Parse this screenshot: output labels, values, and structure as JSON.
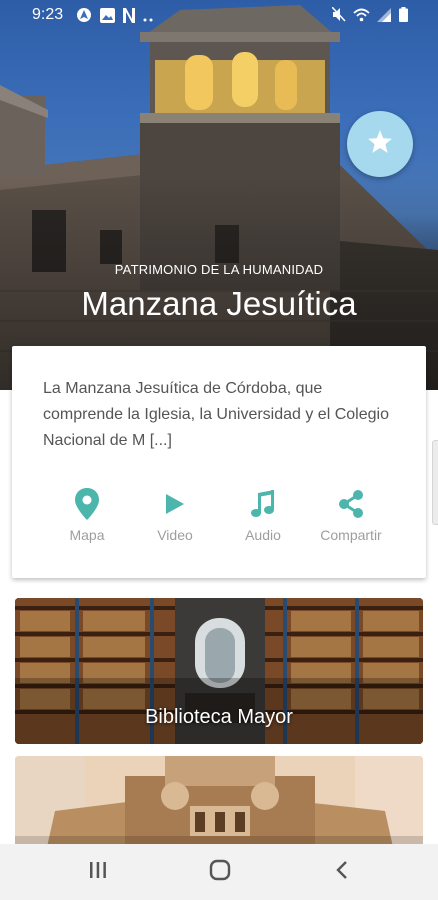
{
  "status_bar": {
    "time": "9:23",
    "left_icons": [
      "android-auto-icon",
      "image-icon",
      "netflix-icon",
      "more-dots-icon"
    ],
    "right_icons": [
      "mute-icon",
      "wifi-icon",
      "signal-icon",
      "battery-icon"
    ]
  },
  "hero": {
    "subtitle": "PATRIMONIO DE LA HUMANIDAD",
    "title": "Manzana Jesuítica",
    "favorite_icon": "star-icon"
  },
  "info_card": {
    "description": "La Manzana Jesuítica de Córdoba, que comprende la Iglesia, la Universidad y el Colegio Nacional de M [...]",
    "actions": [
      {
        "label": "Mapa",
        "icon": "map-pin-icon"
      },
      {
        "label": "Video",
        "icon": "play-icon"
      },
      {
        "label": "Audio",
        "icon": "music-note-icon"
      },
      {
        "label": "Compartir",
        "icon": "share-icon"
      }
    ]
  },
  "places": [
    {
      "label": "Biblioteca Mayor"
    },
    {
      "label": ""
    }
  ],
  "nav_bar": {
    "buttons": [
      "recent-apps-icon",
      "home-icon",
      "back-icon"
    ]
  },
  "colors": {
    "accent": "#4db6ac",
    "fab": "#a6d8ee",
    "text_secondary": "#9e9e9e"
  }
}
